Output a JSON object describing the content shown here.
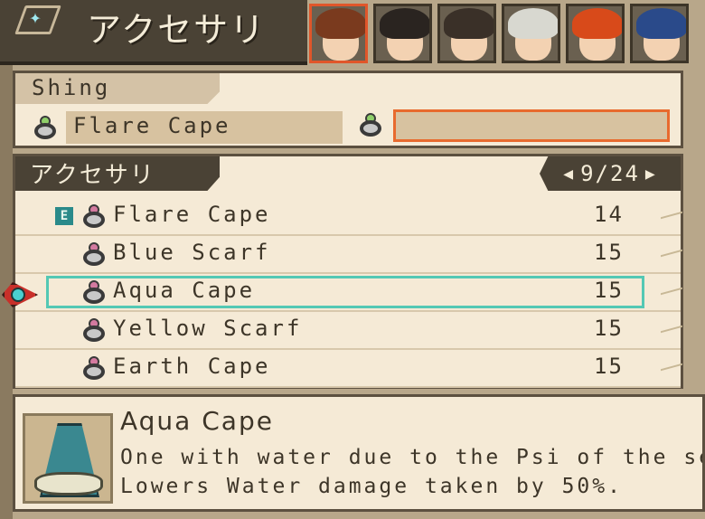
{
  "header": {
    "title": "アクセサリ"
  },
  "portraits": [
    {
      "name": "portrait-1",
      "active": true,
      "hair": "#7a3a1e"
    },
    {
      "name": "portrait-2",
      "active": false,
      "hair": "#2a2420"
    },
    {
      "name": "portrait-3",
      "active": false,
      "hair": "#3a3028"
    },
    {
      "name": "portrait-4",
      "active": false,
      "hair": "#d8d8d0"
    },
    {
      "name": "portrait-5",
      "active": false,
      "hair": "#d84a1a"
    },
    {
      "name": "portrait-6",
      "active": false,
      "hair": "#2a4a8a"
    }
  ],
  "character": {
    "name": "Shing",
    "slot1_value": "Flare Cape",
    "slot2_value": ""
  },
  "list": {
    "category": "アクセサリ",
    "page": "9/24",
    "items": [
      {
        "name": "Flare Cape",
        "qty": "14",
        "equipped": true,
        "equipped_mark": "E",
        "selected": false
      },
      {
        "name": "Blue Scarf",
        "qty": "15",
        "equipped": false,
        "equipped_mark": "",
        "selected": false
      },
      {
        "name": "Aqua Cape",
        "qty": "15",
        "equipped": false,
        "equipped_mark": "",
        "selected": true
      },
      {
        "name": "Yellow Scarf",
        "qty": "15",
        "equipped": false,
        "equipped_mark": "",
        "selected": false
      },
      {
        "name": "Earth Cape",
        "qty": "15",
        "equipped": false,
        "equipped_mark": "",
        "selected": false
      }
    ]
  },
  "description": {
    "title": "Aqua Cape",
    "line1": "One with water due to the Psi of the se",
    "line2": "Lowers Water damage taken by 50%."
  },
  "colors": {
    "selection": "#54c8b4",
    "active_portrait": "#e0562a",
    "empty_slot_border": "#e86a2e"
  }
}
